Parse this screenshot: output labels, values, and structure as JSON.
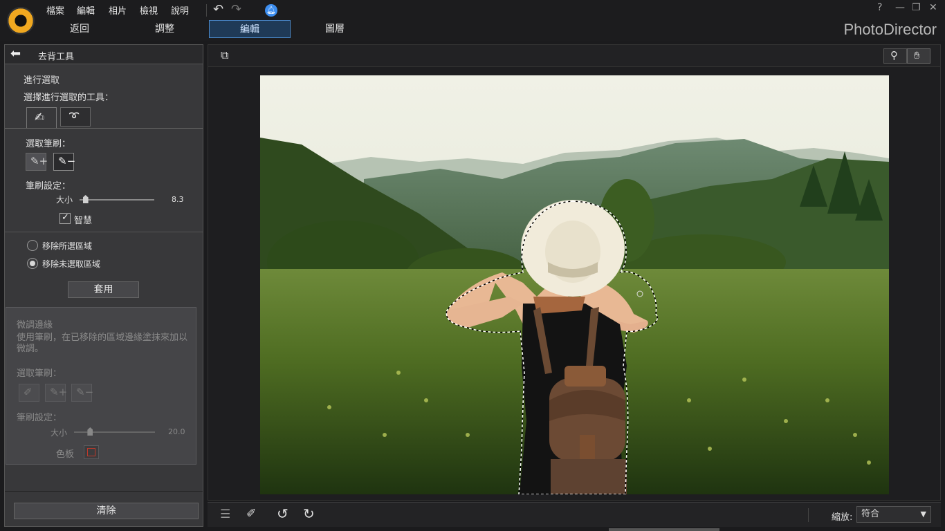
{
  "app": {
    "brand": "PhotoDirector"
  },
  "menu": [
    "檔案",
    "編輯",
    "相片",
    "檢視",
    "說明"
  ],
  "window_controls": {
    "help": "?",
    "minimize": "—",
    "restore": "❐",
    "close": "✕"
  },
  "nav_tabs": [
    "返回",
    "調整",
    "編輯",
    "圖層"
  ],
  "active_tab": "編輯",
  "panel": {
    "title": "去背工具",
    "selection_section": "進行選取",
    "choose_tool_label": "選擇進行選取的工具：",
    "brush_label": "選取筆刷：",
    "brush_settings_label": "筆刷設定：",
    "size_label": "大小",
    "size_value": "8.3",
    "size_fraction": 0.08,
    "smart_label": "智慧",
    "smart_checked": true,
    "remove_selected": "移除所選區域",
    "remove_unselected": "移除未選取區域",
    "remove_choice": "remove_unselected",
    "apply_button": "套用",
    "refine": {
      "title": "微調邊緣",
      "description": "使用筆刷，在已移除的區域邊緣塗抹來加以微調。",
      "brush_label": "選取筆刷：",
      "brush_settings_label": "筆刷設定：",
      "size_label": "大小",
      "size_value": "20.0",
      "size_fraction": 0.2,
      "palette_label": "色板"
    },
    "clear_button": "清除"
  },
  "bottom": {
    "zoom_label": "縮放:",
    "zoom_value": "符合"
  },
  "colors": {
    "accent": "#4a88c9",
    "selection_swatch": "#c0392b"
  }
}
